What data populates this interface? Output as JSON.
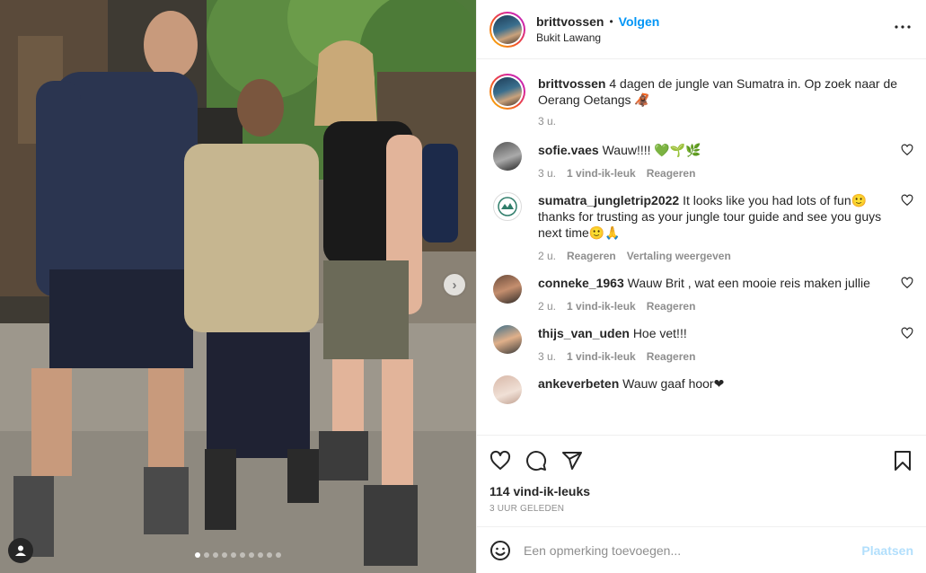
{
  "header": {
    "username": "brittvossen",
    "separator": "•",
    "follow_label": "Volgen",
    "location": "Bukit Lawang",
    "more_icon": "more-horizontal-icon"
  },
  "caption": {
    "username": "brittvossen",
    "text": "4 dagen de jungle van Sumatra in. Op zoek naar de Oerang Oetangs 🦧",
    "time": "3 u."
  },
  "comments": [
    {
      "username": "sofie.vaes",
      "text": "Wauw!!!! 💚🌱🌿",
      "time": "3 u.",
      "likes": "1 vind-ik-leuk",
      "reply": "Reageren",
      "extra": ""
    },
    {
      "username": "sumatra_jungletrip2022",
      "text": "It looks like you had lots of fun🙂 thanks for trusting as your jungle tour guide and see you guys next time🙂🙏",
      "time": "2 u.",
      "likes": "",
      "reply": "Reageren",
      "extra": "Vertaling weergeven"
    },
    {
      "username": "conneke_1963",
      "text": "Wauw Brit , wat een mooie reis maken jullie",
      "time": "2 u.",
      "likes": "1 vind-ik-leuk",
      "reply": "Reageren",
      "extra": ""
    },
    {
      "username": "thijs_van_uden",
      "text": "Hoe vet!!!",
      "time": "3 u.",
      "likes": "1 vind-ik-leuk",
      "reply": "Reageren",
      "extra": ""
    },
    {
      "username": "ankeverbeten",
      "text": "Wauw gaaf hoor❤",
      "time": "",
      "likes": "",
      "reply": "",
      "extra": ""
    }
  ],
  "actions": {
    "like_icon": "heart-icon",
    "comment_icon": "comment-icon",
    "share_icon": "send-icon",
    "save_icon": "bookmark-icon",
    "likes_count": "114 vind-ik-leuks",
    "posted": "3 UUR GELEDEN"
  },
  "add_comment": {
    "emoji_icon": "emoji-icon",
    "placeholder": "Een opmerking toevoegen...",
    "post_label": "Plaatsen"
  },
  "carousel": {
    "next_icon": "chevron-right-icon",
    "tag_icon": "user-tag-icon",
    "slide_count": 10,
    "active_slide": 1
  },
  "colors": {
    "link_blue": "#0095f6",
    "disabled_blue": "#b2dffc",
    "muted": "#8e8e8e",
    "text": "#262626"
  }
}
